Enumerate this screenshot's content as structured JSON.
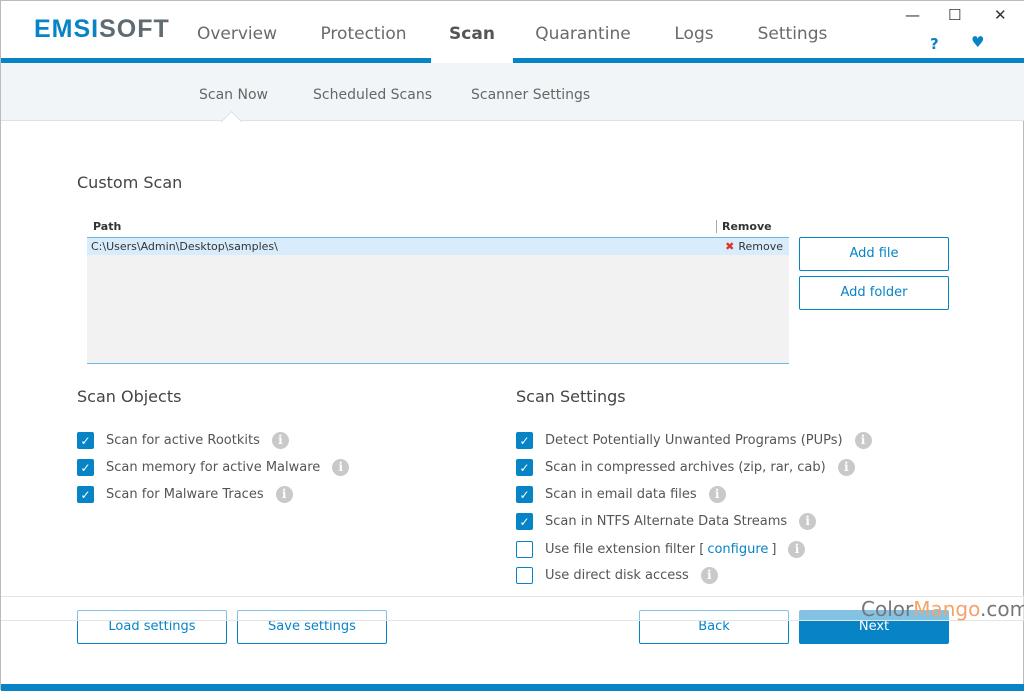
{
  "app": {
    "logo_part1": "EMSI",
    "logo_part2": "SOFT"
  },
  "nav": {
    "tabs": [
      {
        "label": "Overview"
      },
      {
        "label": "Protection"
      },
      {
        "label": "Scan",
        "active": true
      },
      {
        "label": "Quarantine"
      },
      {
        "label": "Logs"
      },
      {
        "label": "Settings"
      }
    ],
    "help": "?",
    "heart": "♥",
    "minimize": "—",
    "maximize": "☐",
    "close": "✕"
  },
  "subnav": {
    "tabs": [
      {
        "label": "Scan Now",
        "active": true
      },
      {
        "label": "Scheduled Scans"
      },
      {
        "label": "Scanner Settings"
      }
    ]
  },
  "custom_scan": {
    "title": "Custom Scan",
    "col_path": "Path",
    "col_remove": "Remove",
    "rows": [
      {
        "path": "C:\\Users\\Admin\\Desktop\\samples\\",
        "remove": "Remove"
      }
    ],
    "add_file": "Add file",
    "add_folder": "Add folder"
  },
  "scan_objects": {
    "title": "Scan Objects",
    "items": [
      {
        "label": "Scan for active Rootkits",
        "checked": true
      },
      {
        "label": "Scan memory for active Malware",
        "checked": true
      },
      {
        "label": "Scan for Malware Traces",
        "checked": true
      }
    ]
  },
  "scan_settings": {
    "title": "Scan Settings",
    "items": [
      {
        "label": "Detect Potentially Unwanted Programs (PUPs)",
        "checked": true
      },
      {
        "label": "Scan in compressed archives (zip, rar, cab)",
        "checked": true
      },
      {
        "label": "Scan in email data files",
        "checked": true
      },
      {
        "label": "Scan in NTFS Alternate Data Streams",
        "checked": true
      },
      {
        "label": "Use file extension filter [",
        "link": "configure",
        "suffix": "]",
        "checked": false
      },
      {
        "label": "Use direct disk access",
        "checked": false
      }
    ]
  },
  "footer": {
    "load": "Load settings",
    "save": "Save settings",
    "back": "Back",
    "next": "Next"
  },
  "watermark": {
    "part1": "Color",
    "part2": "Mango",
    "part3": ".com"
  },
  "colors": {
    "accent": "#0784c5"
  }
}
